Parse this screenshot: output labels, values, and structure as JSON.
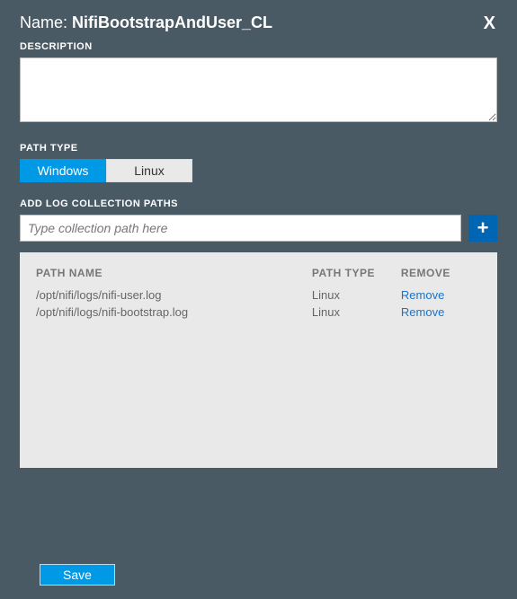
{
  "header": {
    "name_label": "Name:",
    "name_value": "NifiBootstrapAndUser_CL",
    "close_label": "X"
  },
  "labels": {
    "description": "DESCRIPTION",
    "path_type": "PATH TYPE",
    "add_paths": "ADD LOG COLLECTION PATHS"
  },
  "description_value": "",
  "path_type": {
    "options": [
      "Windows",
      "Linux"
    ],
    "selected": "Windows"
  },
  "path_input": {
    "placeholder": "Type collection path here",
    "value": ""
  },
  "add_button_label": "+",
  "table": {
    "headers": {
      "path_name": "PATH NAME",
      "path_type": "PATH TYPE",
      "remove": "REMOVE"
    },
    "rows": [
      {
        "path_name": "/opt/nifi/logs/nifi-user.log",
        "path_type": "Linux",
        "remove": "Remove"
      },
      {
        "path_name": "/opt/nifi/logs/nifi-bootstrap.log",
        "path_type": "Linux",
        "remove": "Remove"
      }
    ]
  },
  "save_label": "Save"
}
